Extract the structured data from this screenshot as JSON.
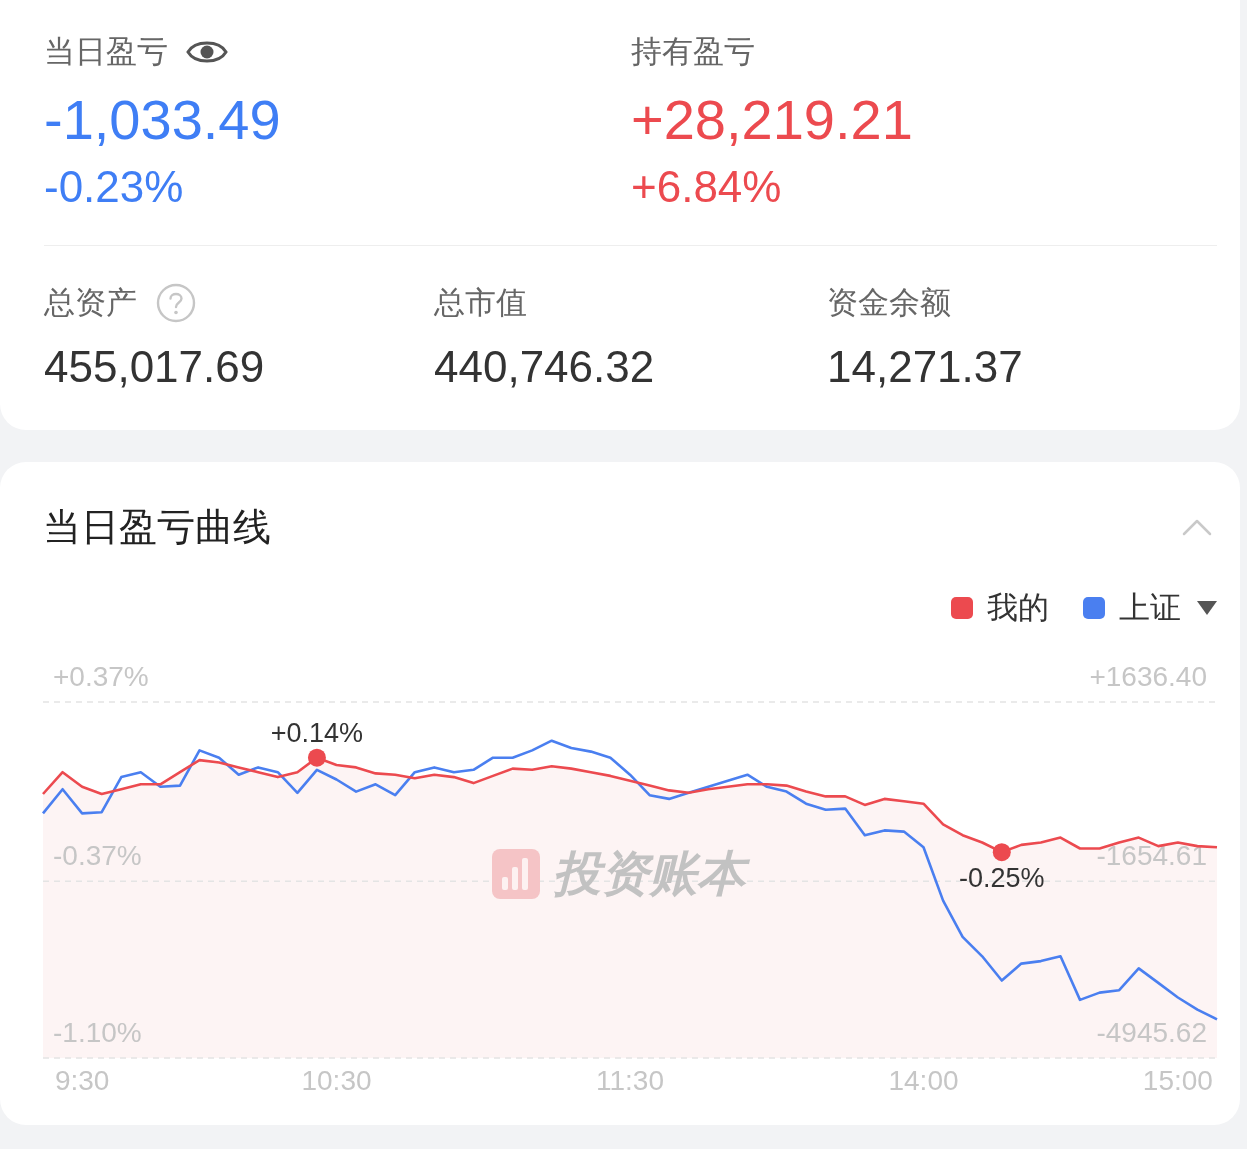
{
  "summary": {
    "pnl": [
      {
        "label": "当日盈亏",
        "amount": "-1,033.49",
        "percent": "-0.23%",
        "color": "#3f7ef5"
      },
      {
        "label": "持有盈亏",
        "amount": "+28,219.21",
        "percent": "+6.84%",
        "color": "#ec4a4f"
      }
    ],
    "privacy_toggle": {
      "visible": true
    },
    "stats": [
      {
        "kind": "help",
        "label": "总资产",
        "value": "455,017.69"
      },
      {
        "kind": "plain",
        "label": "总市值",
        "value": "440,746.32"
      },
      {
        "kind": "plain",
        "label": "资金余额",
        "value": "14,271.37"
      }
    ]
  },
  "chart_panel": {
    "title": "当日盈亏曲线",
    "expanded": true,
    "benchmark_picker": {
      "expanded": false
    },
    "watermark": "投资账本",
    "right_axis_labels": [
      "+1636.40",
      "-1654.61",
      "-4945.62"
    ],
    "chart_data": {
      "type": "line",
      "categories": [
        null,
        null,
        "9:30",
        null,
        null,
        null,
        null,
        null,
        null,
        null,
        null,
        null,
        null,
        null,
        null,
        "10:30",
        null,
        null,
        null,
        null,
        null,
        null,
        null,
        null,
        null,
        null,
        null,
        null,
        null,
        null,
        "11:30",
        null,
        null,
        null,
        null,
        null,
        null,
        null,
        null,
        null,
        null,
        null,
        null,
        null,
        null,
        "14:00",
        null,
        null,
        null,
        null,
        null,
        null,
        null,
        null,
        null,
        null,
        null,
        null,
        "15:00",
        null,
        null
      ],
      "ylim": [
        -1.1,
        0.37
      ],
      "yticks": [
        {
          "value": 0.37,
          "label": "+0.37%"
        },
        {
          "value": -0.37,
          "label": "-0.37%"
        },
        {
          "value": -1.1,
          "label": "-1.10%"
        }
      ],
      "series": [
        {
          "name": "我的",
          "color": "#ec4a4f",
          "values": [
            -0.01,
            0.08,
            0.02,
            -0.01,
            0.01,
            0.03,
            0.03,
            0.08,
            0.13,
            0.12,
            0.1,
            0.08,
            0.06,
            0.08,
            0.14,
            0.11,
            0.1,
            0.075,
            0.07,
            0.055,
            0.07,
            0.06,
            0.035,
            0.065,
            0.095,
            0.09,
            0.105,
            0.095,
            0.08,
            0.065,
            0.045,
            0.025,
            0.005,
            -0.005,
            0.01,
            0.02,
            0.03,
            0.03,
            0.025,
            0.0,
            -0.02,
            -0.02,
            -0.055,
            -0.03,
            -0.04,
            -0.05,
            -0.135,
            -0.18,
            -0.21,
            -0.25,
            -0.22,
            -0.21,
            -0.19,
            -0.235,
            -0.235,
            -0.21,
            -0.19,
            -0.225,
            -0.21,
            -0.225,
            -0.23
          ]
        },
        {
          "name": "上证",
          "color": "#4a7ff0",
          "values": [
            -0.09,
            0.01,
            -0.09,
            -0.085,
            0.06,
            0.08,
            0.02,
            0.025,
            0.17,
            0.14,
            0.07,
            0.1,
            0.08,
            -0.005,
            0.09,
            0.05,
            0.0,
            0.03,
            -0.015,
            0.08,
            0.1,
            0.08,
            0.09,
            0.14,
            0.14,
            0.17,
            0.21,
            0.18,
            0.165,
            0.14,
            0.07,
            -0.015,
            -0.03,
            -0.005,
            0.02,
            0.045,
            0.07,
            0.02,
            0.0,
            -0.05,
            -0.075,
            -0.07,
            -0.18,
            -0.16,
            -0.165,
            -0.23,
            -0.45,
            -0.6,
            -0.68,
            -0.78,
            -0.71,
            -0.7,
            -0.68,
            -0.86,
            -0.83,
            -0.82,
            -0.73,
            -0.79,
            -0.85,
            -0.9,
            -0.94
          ]
        }
      ],
      "annotations": [
        {
          "y": 0.14,
          "text": "+0.14%"
        },
        {
          "y": -0.25,
          "text": "-0.25%"
        }
      ]
    }
  }
}
